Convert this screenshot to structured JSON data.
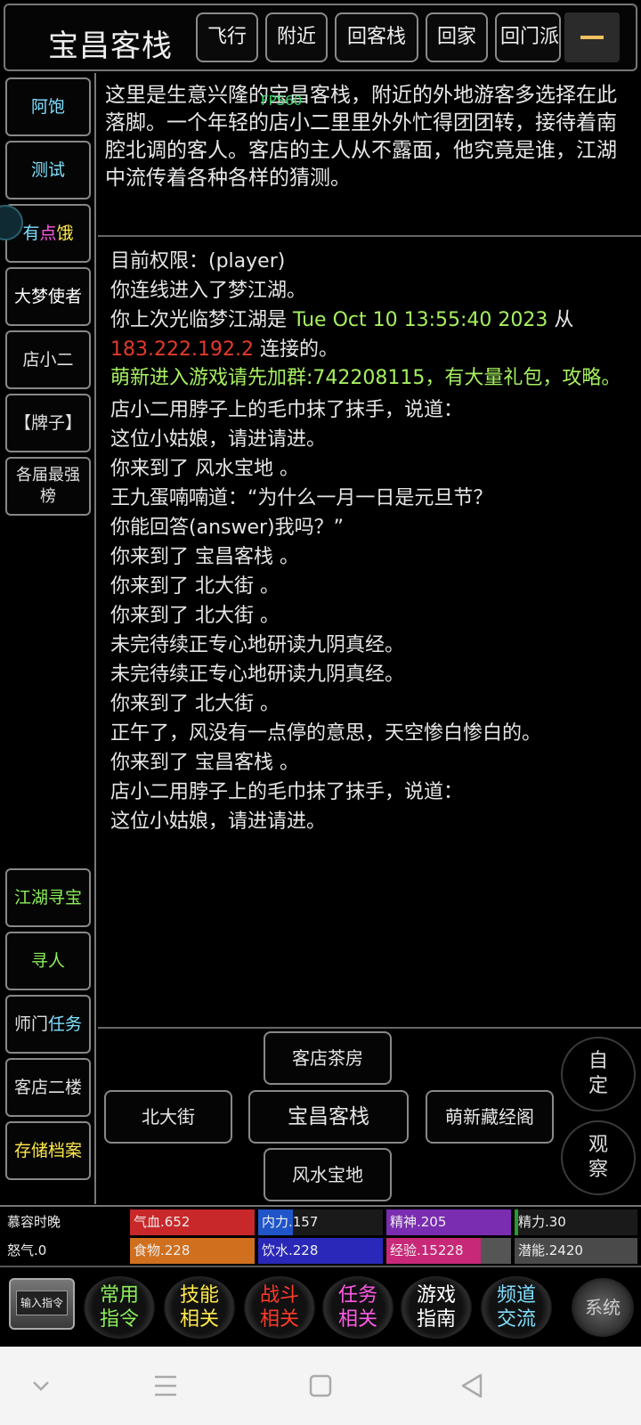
{
  "header": {
    "room_title": "宝昌客栈",
    "buttons": [
      "飞行",
      "附近",
      "回客栈",
      "回家",
      "回门派"
    ]
  },
  "overlay": {
    "fps": "FPS60"
  },
  "sidebar": {
    "items": [
      {
        "label": "阿饱"
      },
      {
        "label": "测试"
      },
      {
        "label_a": "有",
        "label_b": "点",
        "label_c": "饿"
      },
      {
        "label": "大梦使者"
      },
      {
        "label": "店小二"
      },
      {
        "label": "【牌子】"
      },
      {
        "label": "各届最强榜"
      }
    ],
    "bottom_items": [
      {
        "label": "江湖寻宝"
      },
      {
        "label": "寻人"
      },
      {
        "label_a": "师门",
        "label_b": "任务"
      },
      {
        "label": "客店二楼"
      },
      {
        "label": "存储档案"
      }
    ]
  },
  "description": "这里是生意兴隆的宝昌客栈，附近的外地游客多选择在此落脚。一个年轻的店小二里里外外忙得团团转，接待着南腔北调的客人。客店的主人从不露面，他究竟是谁，江湖中流传着各种各样的猜测。",
  "log": {
    "l1": "目前权限：(player)",
    "l2": "你连线进入了梦江湖。",
    "l3a": "你上次光临梦江湖是 ",
    "l3b": "Tue Oct 10 13:55:40 2023",
    "l3c": " 从",
    "l4a": "183.222.192.2",
    "l4b": " 连接的。",
    "l5": "萌新进入游戏请先加群:742208115，有大量礼包，攻略。",
    "l6": "店小二用脖子上的毛巾抹了抹手，说道：",
    "l7": "这位小姑娘，请进请进。",
    "l8": "你来到了 风水宝地 。",
    "l9": "王九蛋喃喃道：“为什么一月一日是元旦节？",
    "l10": "你能回答(answer)我吗？”",
    "l11": "你来到了 宝昌客栈 。",
    "l12": "你来到了 北大街 。",
    "l13": "你来到了 北大街 。",
    "l14": "未完待续正专心地研读九阴真经。",
    "l15": "未完待续正专心地研读九阴真经。",
    "l16": "你来到了 北大街 。",
    "l17": "正午了，风没有一点停的意思，天空惨白惨白的。",
    "l18": "你来到了 宝昌客栈 。",
    "l19": "店小二用脖子上的毛巾抹了抹手，说道：",
    "l20": "这位小姑娘，请进请进。"
  },
  "exits": {
    "north": "客店茶房",
    "west": "北大街",
    "center": "宝昌客栈",
    "east": "萌新藏经阁",
    "south": "风水宝地"
  },
  "round_buttons": {
    "custom": "自定",
    "observe": "观察"
  },
  "status": {
    "row1": {
      "time": "慕容时晚",
      "hp": "气血.652",
      "neili": "内力.157",
      "jingshen": "精神.205",
      "jingli": "精力.30"
    },
    "row2": {
      "nuqi": "怒气.0",
      "food": "食物.228",
      "water": "饮水.228",
      "exp": "经验.15228",
      "qianneng": "潜能.2420"
    },
    "fills": {
      "hp": 1.0,
      "neili": 0.28,
      "jingshen": 1.0,
      "jingli": 0.03,
      "food": 1.0,
      "water": 1.0,
      "exp": 0.76
    },
    "colors": {
      "hp": "#c8282a",
      "neili": "#1f55c8",
      "jingshen": "#7a2db0",
      "jingli": "#2a9a30",
      "food": "#d0701e",
      "water": "#2a28b8",
      "exp": "#c82878"
    }
  },
  "commands": {
    "input": "输入指令",
    "c1a": "常用",
    "c1b": "指令",
    "c2a": "技能",
    "c2b": "相关",
    "c3a": "战斗",
    "c3b": "相关",
    "c4a": "任务",
    "c4b": "相关",
    "c5a": "游戏",
    "c5b": "指南",
    "c6a": "频道",
    "c6b": "交流",
    "system": "系统"
  }
}
